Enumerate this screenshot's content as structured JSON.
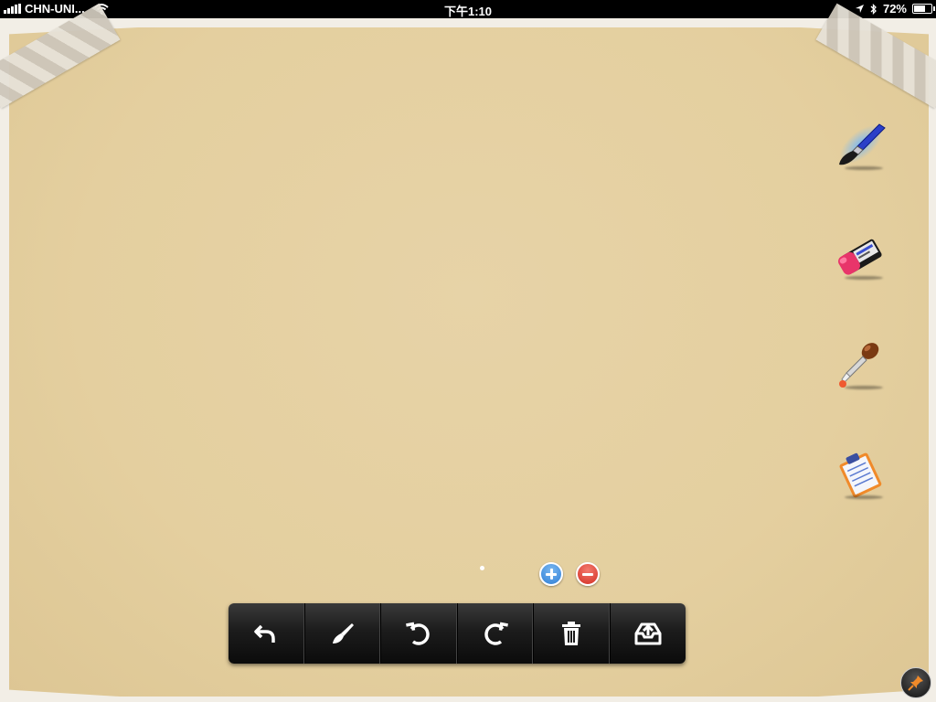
{
  "status_bar": {
    "carrier": "CHN-UNI...",
    "time": "下午1:10",
    "battery_percent_label": "72%",
    "battery_level": 0.72,
    "icons": [
      "signal-bars-icon",
      "wifi-icon",
      "location-arrow-icon",
      "bluetooth-icon",
      "battery-icon"
    ]
  },
  "canvas": {
    "paper_color": "#e5d0a2",
    "tape_color": "#ddd7cb"
  },
  "tools": [
    {
      "name": "paintbrush",
      "icon": "paintbrush-icon",
      "selected": true
    },
    {
      "name": "eraser",
      "icon": "eraser-icon",
      "selected": false
    },
    {
      "name": "dropper",
      "icon": "dropper-icon",
      "selected": false
    },
    {
      "name": "notepad",
      "icon": "notepad-icon",
      "selected": false
    }
  ],
  "zoom": {
    "in_icon": "plus-circle-icon",
    "out_icon": "minus-circle-icon",
    "in_color": "#3a8ae0",
    "out_color": "#d9382c"
  },
  "toolbar": {
    "buttons": [
      {
        "name": "back",
        "icon": "back-arrow-icon"
      },
      {
        "name": "brush",
        "icon": "brush-icon"
      },
      {
        "name": "undo",
        "icon": "undo-icon"
      },
      {
        "name": "redo",
        "icon": "redo-icon"
      },
      {
        "name": "delete",
        "icon": "trash-icon"
      },
      {
        "name": "export",
        "icon": "upload-tray-icon"
      }
    ]
  },
  "pin": {
    "icon": "pushpin-icon",
    "color": "#f08a2a"
  }
}
